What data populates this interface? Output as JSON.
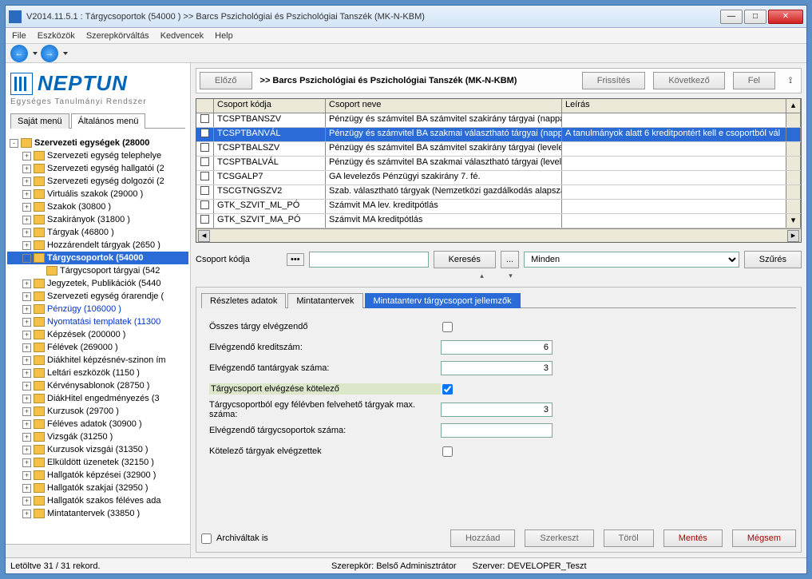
{
  "title": "V2014.11.5.1 : Tárgycsoportok (54000 )  >> Barcs Pszichológiai és Pszichológiai Tanszék (MK-N-KBM)",
  "menu": [
    "File",
    "Eszközök",
    "Szerepkörváltás",
    "Kedvencek",
    "Help"
  ],
  "logo": "NEPTUN",
  "logo_sub": "Egységes Tanulmányi Rendszer",
  "left_tabs": {
    "a": "Saját menü",
    "b": "Általános menü"
  },
  "tree": [
    {
      "d": 0,
      "exp": "-",
      "bold": 1,
      "label": "Szervezeti egységek (28000"
    },
    {
      "d": 1,
      "exp": "+",
      "label": "Szervezeti egység telephelye"
    },
    {
      "d": 1,
      "exp": "+",
      "label": "Szervezeti egység hallgatói (2"
    },
    {
      "d": 1,
      "exp": "+",
      "label": "Szervezeti egység dolgozói (2"
    },
    {
      "d": 1,
      "exp": "+",
      "label": "Virtuális szakok (29000 )"
    },
    {
      "d": 1,
      "exp": "+",
      "label": "Szakok (30800 )"
    },
    {
      "d": 1,
      "exp": "+",
      "label": "Szakirányok (31800 )"
    },
    {
      "d": 1,
      "exp": "+",
      "label": "Tárgyak (46800 )"
    },
    {
      "d": 1,
      "exp": "+",
      "label": "Hozzárendelt tárgyak (2650 )"
    },
    {
      "d": 1,
      "exp": "-",
      "bold": 1,
      "sel": 1,
      "label": "Tárgycsoportok (54000"
    },
    {
      "d": 2,
      "noexp": 1,
      "label": "Tárgycsoport tárgyai (542"
    },
    {
      "d": 1,
      "exp": "+",
      "label": "Jegyzetek, Publikációk (5440"
    },
    {
      "d": 1,
      "exp": "+",
      "label": "Szervezeti egység órarendje ("
    },
    {
      "d": 1,
      "exp": "+",
      "blue": 1,
      "label": "Pénzügy (106000 )"
    },
    {
      "d": 1,
      "exp": "+",
      "blue": 1,
      "label": "Nyomtatási templatek (11300"
    },
    {
      "d": 1,
      "exp": "+",
      "label": "Képzések (200000 )"
    },
    {
      "d": 1,
      "exp": "+",
      "label": "Félévek (269000 )"
    },
    {
      "d": 1,
      "exp": "+",
      "label": "Diákhitel képzésnév-szinon ím"
    },
    {
      "d": 1,
      "exp": "+",
      "label": "Leltári eszközök (1150 )"
    },
    {
      "d": 1,
      "exp": "+",
      "label": "Kérvénysablonok (28750 )"
    },
    {
      "d": 1,
      "exp": "+",
      "label": "DiákHitel engedményezés (3"
    },
    {
      "d": 1,
      "exp": "+",
      "label": "Kurzusok (29700 )"
    },
    {
      "d": 1,
      "exp": "+",
      "label": "Féléves adatok (30900 )"
    },
    {
      "d": 1,
      "exp": "+",
      "label": "Vizsgák (31250 )"
    },
    {
      "d": 1,
      "exp": "+",
      "label": "Kurzusok vizsgái (31350 )"
    },
    {
      "d": 1,
      "exp": "+",
      "label": "Elküldött üzenetek (32150 )"
    },
    {
      "d": 1,
      "exp": "+",
      "label": "Hallgatók képzései (32900 )"
    },
    {
      "d": 1,
      "exp": "+",
      "label": "Hallgatók szakjai (32950 )"
    },
    {
      "d": 1,
      "exp": "+",
      "label": "Hallgatók szakos féléves ada"
    },
    {
      "d": 1,
      "exp": "+",
      "label": "Mintatantervek (33850 )"
    }
  ],
  "header": {
    "prev": "Előző",
    "title": ">> Barcs Pszichológiai és Pszichológiai Tanszék (MK-N-KBM)",
    "refresh": "Frissítés",
    "next": "Következő",
    "up": "Fel"
  },
  "grid": {
    "cols": [
      "Csoport kódja",
      "Csoport neve",
      "Leírás"
    ],
    "rows": [
      {
        "c": [
          "TCSPTBANSZV",
          "Pénzügy és számvitel BA számvitel szakirány tárgyai (nappali",
          ""
        ]
      },
      {
        "sel": 1,
        "c": [
          "TCSPTBANVÁL",
          "Pénzügy és számvitel BA szakmai választható tárgyai (nappali",
          "A tanulmányok alatt 6 kreditpontért kell e csoportból vál"
        ]
      },
      {
        "c": [
          "TCSPTBALSZV",
          "Pénzügy és számvitel BA számvitel szakirány tárgyai (levelez",
          ""
        ]
      },
      {
        "c": [
          "TCSPTBALVÁL",
          "Pénzügy és számvitel BA szakmai választható tárgyai  (levele",
          ""
        ]
      },
      {
        "c": [
          "TCSGALP7",
          "GA levelezős Pénzügyi szakirány 7. fé.",
          ""
        ]
      },
      {
        "c": [
          "TSCGTNGSZV2",
          "Szab. választható tárgyak (Nemzetközi gazdálkodás alapszak",
          ""
        ]
      },
      {
        "c": [
          "GTK_SZVIT_ML_PÓ",
          "Számvit MA lev. kreditpótlás",
          ""
        ]
      },
      {
        "c": [
          "GTK_SZVIT_MA_PÓ",
          "Számvit MA kreditpótlás",
          ""
        ]
      }
    ]
  },
  "search": {
    "label": "Csoport kódja",
    "btn": "Keresés",
    "dots": "...",
    "filter": "Minden",
    "filterbtn": "Szűrés"
  },
  "dtabs": {
    "a": "Részletes adatok",
    "b": "Mintatantervek",
    "c": "Mintatanterv tárgycsoport jellemzők"
  },
  "form": {
    "r1": "Összes tárgy elvégzendő",
    "r2": "Elvégzendő kreditszám:",
    "v2": "6",
    "r3": "Elvégzendő tantárgyak száma:",
    "v3": "3",
    "r4": "Tárgycsoport elvégzése kötelező",
    "r5": "Tárgycsoportból egy félévben felvehető tárgyak max. száma:",
    "v5": "3",
    "r6": "Elvégzendő tárgycsoportok száma:",
    "r7": "Kötelező tárgyak elvégzettek"
  },
  "bottom": {
    "arch": "Archiváltak is",
    "add": "Hozzáad",
    "edit": "Szerkeszt",
    "del": "Töröl",
    "save": "Mentés",
    "cancel": "Mégsem"
  },
  "status": {
    "left": "Letöltve 31 / 31 rekord.",
    "role": "Szerepkör: Belső Adminisztrátor",
    "srv": "Szerver: DEVELOPER_Teszt"
  }
}
